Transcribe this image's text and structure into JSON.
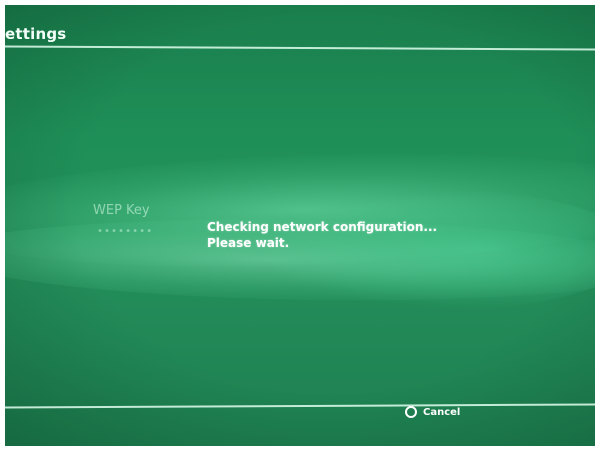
{
  "header": {
    "title": "ettings"
  },
  "form": {
    "wep_key_label": "WEP Key",
    "wep_key_value": "••••••••"
  },
  "status": {
    "line1": "Checking network configuration...",
    "line2": "Please wait."
  },
  "footer": {
    "cancel_icon": "circle-button-icon",
    "cancel_label": "Cancel"
  },
  "colors": {
    "background": "#1f8f58",
    "text": "#ffffff"
  }
}
